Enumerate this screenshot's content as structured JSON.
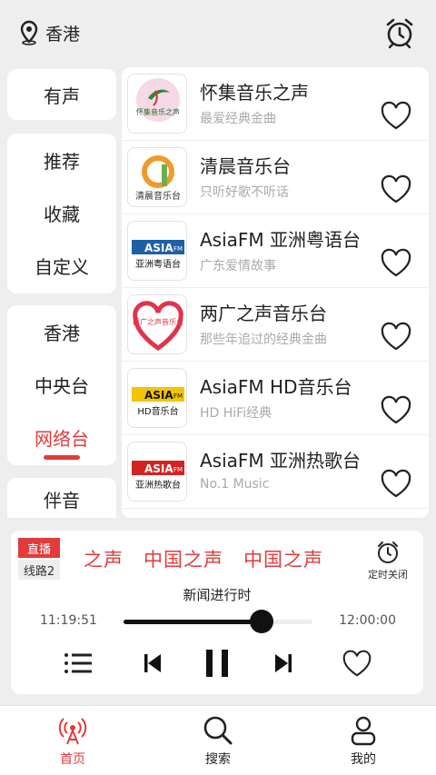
{
  "header": {
    "location": "香港",
    "location_icon": "location-pin-icon",
    "alarm_icon": "alarm-clock-icon"
  },
  "categories": {
    "group1": [
      "有声"
    ],
    "group2": [
      "推荐",
      "收藏",
      "自定义"
    ],
    "group3": [
      "香港",
      "中央台",
      "网络台"
    ],
    "group4": [
      "伴音"
    ],
    "active": "网络台",
    "accent": "#e23b3b"
  },
  "stations": [
    {
      "name": "怀集音乐之声",
      "desc": "最爱经典金曲",
      "logo_text": "怀集音乐之声"
    },
    {
      "name": "清晨音乐台",
      "desc": "只听好歌不听话",
      "logo_text": "清晨音乐台"
    },
    {
      "name": "AsiaFM 亚洲粤语台",
      "desc": "广东爱情故事",
      "logo_text": "亚洲粤语台"
    },
    {
      "name": "两广之声音乐台",
      "desc": "那些年追过的经典金曲",
      "logo_text": "两广之声音乐台"
    },
    {
      "name": "AsiaFM HD音乐台",
      "desc": "HD HiFi经典",
      "logo_text": "HD音乐台"
    },
    {
      "name": "AsiaFM 亚洲热歌台",
      "desc": "No.1 Music",
      "logo_text": "亚洲热歌台"
    }
  ],
  "player": {
    "live_label": "直播",
    "line_label": "线路2",
    "marquee": "之声　中国之声　中国之声",
    "timer_label": "定时关闭",
    "program": "新闻进行时",
    "time_start": "11:19:51",
    "time_end": "12:00:00",
    "progress": 0.73
  },
  "nav": [
    {
      "label": "首页",
      "icon": "radio-broadcast-icon",
      "active": true
    },
    {
      "label": "搜索",
      "icon": "search-icon",
      "active": false
    },
    {
      "label": "我的",
      "icon": "user-icon",
      "active": false
    }
  ]
}
